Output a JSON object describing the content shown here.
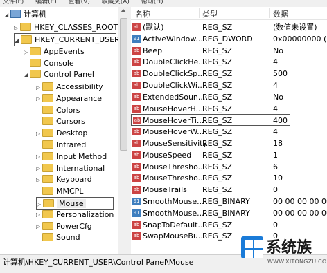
{
  "menu": [
    "文件(F)",
    "编辑(E)",
    "查看(V)",
    "收藏夹(A)",
    "帮助(H)"
  ],
  "tree": {
    "computer": "计算机",
    "hkcr": "HKEY_CLASSES_ROOT",
    "hkcu": "HKEY_CURRENT_USER",
    "appevents": "AppEvents",
    "console": "Console",
    "control_panel": "Control Panel",
    "children": [
      "Accessibility",
      "Appearance",
      "Colors",
      "Cursors",
      "Desktop",
      "Infrared",
      "Input Method",
      "International",
      "Keyboard",
      "MMCPL",
      "Mouse",
      "Personalization",
      "PowerCfg",
      "Sound"
    ]
  },
  "columns": {
    "name": "名称",
    "type": "类型",
    "data": "数据"
  },
  "values": [
    {
      "icon": "ab",
      "name": "(默认)",
      "type": "REG_SZ",
      "data": "(数值未设置)"
    },
    {
      "icon": "bin",
      "name": "ActiveWindow...",
      "type": "REG_DWORD",
      "data": "0x00000000 (0)"
    },
    {
      "icon": "ab",
      "name": "Beep",
      "type": "REG_SZ",
      "data": "No"
    },
    {
      "icon": "ab",
      "name": "DoubleClickHe...",
      "type": "REG_SZ",
      "data": "4"
    },
    {
      "icon": "ab",
      "name": "DoubleClickSp...",
      "type": "REG_SZ",
      "data": "500"
    },
    {
      "icon": "ab",
      "name": "DoubleClickWi...",
      "type": "REG_SZ",
      "data": "4"
    },
    {
      "icon": "ab",
      "name": "ExtendedSoun...",
      "type": "REG_SZ",
      "data": "No"
    },
    {
      "icon": "ab",
      "name": "MouseHoverH...",
      "type": "REG_SZ",
      "data": "4"
    },
    {
      "icon": "ab",
      "name": "MouseHoverTi...",
      "type": "REG_SZ",
      "data": "400"
    },
    {
      "icon": "ab",
      "name": "MouseHoverW...",
      "type": "REG_SZ",
      "data": "4"
    },
    {
      "icon": "ab",
      "name": "MouseSensitivity",
      "type": "REG_SZ",
      "data": "18"
    },
    {
      "icon": "ab",
      "name": "MouseSpeed",
      "type": "REG_SZ",
      "data": "1"
    },
    {
      "icon": "ab",
      "name": "MouseThresho...",
      "type": "REG_SZ",
      "data": "6"
    },
    {
      "icon": "ab",
      "name": "MouseThresho...",
      "type": "REG_SZ",
      "data": "10"
    },
    {
      "icon": "ab",
      "name": "MouseTrails",
      "type": "REG_SZ",
      "data": "0"
    },
    {
      "icon": "bin",
      "name": "SmoothMouse...",
      "type": "REG_BINARY",
      "data": "00 00 00 00 00 00"
    },
    {
      "icon": "bin",
      "name": "SmoothMouse...",
      "type": "REG_BINARY",
      "data": "00 00 00 00 00 00"
    },
    {
      "icon": "ab",
      "name": "SnapToDefault...",
      "type": "REG_SZ",
      "data": "0"
    },
    {
      "icon": "ab",
      "name": "SwapMouseBu...",
      "type": "REG_SZ",
      "data": "0"
    }
  ],
  "status_path": "计算机\\HKEY_CURRENT_USER\\Control Panel\\Mouse",
  "watermark": {
    "brand": "系统族",
    "url": "WWW.XITONGZU.COM"
  },
  "colors": {
    "folder": "#f1c74d",
    "string_icon": "#cc4444",
    "binary_icon": "#3f7fbf"
  }
}
